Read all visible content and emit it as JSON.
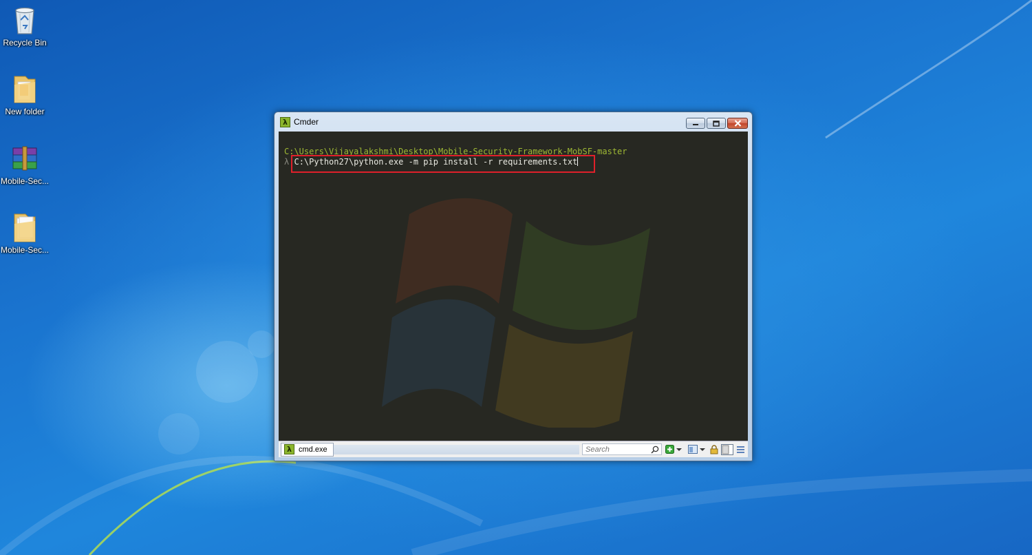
{
  "desktop": {
    "icons": [
      {
        "label": "Recycle Bin",
        "icon": "recycle-bin-icon"
      },
      {
        "label": "New folder",
        "icon": "folder-icon"
      },
      {
        "label": "Mobile-Sec...",
        "icon": "winrar-archive-icon"
      },
      {
        "label": "Mobile-Sec...",
        "icon": "folder-icon"
      }
    ]
  },
  "window": {
    "title": "Cmder",
    "app_icon_glyph": "λ",
    "controls": {
      "minimize": "minimize-icon",
      "maximize": "maximize-icon",
      "close": "close-icon"
    }
  },
  "terminal": {
    "path_line": "C:\\Users\\Vijayalakshmi\\Desktop\\Mobile-Security-Framework-MobSF-master",
    "prompt_symbol": "λ",
    "command": "C:\\Python27\\python.exe -m pip install -r requirements.txt",
    "colors": {
      "background": "#272822",
      "path": "#9fb934",
      "text": "#e8e8e0",
      "highlight": "#e0202a"
    }
  },
  "statusbar": {
    "tab_glyph": "λ",
    "tab_label": "cmd.exe",
    "search_placeholder": "Search"
  }
}
